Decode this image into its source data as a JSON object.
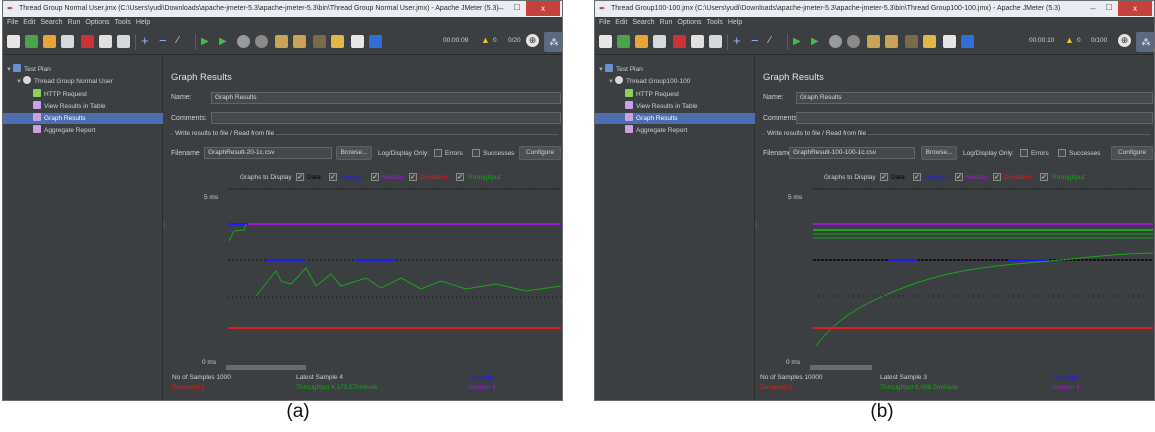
{
  "panels": [
    {
      "id": "a",
      "caption": "(a)",
      "window_title": "Thread Group Normal User.jmx (C:\\Users\\yudi\\Downloads\\apache-jmeter-5.3\\apache-jmeter-5.3\\bin\\Thread Group Normal User.jmx) - Apache JMeter (5.3)",
      "menu": [
        "File",
        "Edit",
        "Search",
        "Run",
        "Options",
        "Tools",
        "Help"
      ],
      "toolbar": {
        "elapsed": "00:00:09",
        "warnings": "0",
        "threads": "0/20",
        "window_controls": {
          "close": "x"
        }
      },
      "tree": {
        "test_plan": "Test Plan",
        "thread_group": "Thread Group Normal User",
        "items": [
          "HTTP Request",
          "View Results in Table",
          "Graph Results",
          "Aggregate Report"
        ],
        "selected": "Graph Results"
      },
      "main": {
        "heading": "Graph Results",
        "name_label": "Name:",
        "name_value": "Graph Results",
        "comments_label": "Comments:",
        "fieldset_legend": "Write results to file / Read from file",
        "filename_label": "Filename",
        "filename_value": "GraphResult-20-1c.csv",
        "browse": "Browse...",
        "log_display_only": "Log/Display Only:",
        "errors": "Errors",
        "successes": "Successes",
        "configure": "Configure",
        "graphs_to_display": "Graphs to Display",
        "legend": [
          {
            "label": "Data",
            "color": "#000000"
          },
          {
            "label": "Average",
            "color": "#1a1aff"
          },
          {
            "label": "Median",
            "color": "#9b1bd1"
          },
          {
            "label": "Deviation",
            "color": "#e01d1d"
          },
          {
            "label": "Throughput",
            "color": "#1fa01f"
          }
        ],
        "y_top": "5 ms",
        "y_bottom": "0 ms",
        "no_of_samples": "No of Samples 1000",
        "latest_sample": "Latest Sample 4",
        "average": "Average 4",
        "deviation": "Deviation 1",
        "throughput": "Throughput 4,172.57/minute",
        "median": "Median 4"
      }
    },
    {
      "id": "b",
      "caption": "(b)",
      "window_title": "Thread Group100-100.jmx (C:\\Users\\yudi\\Downloads\\apache-jmeter-5.3\\apache-jmeter-5.3\\bin\\Thread Group100-100.jmx) - Apache JMeter (5.3)",
      "menu": [
        "File",
        "Edit",
        "Search",
        "Run",
        "Options",
        "Tools",
        "Help"
      ],
      "toolbar": {
        "elapsed": "00:00:10",
        "warnings": "0",
        "threads": "0/100",
        "window_controls": {
          "close": "x"
        }
      },
      "tree": {
        "test_plan": "Test Plan",
        "thread_group": "Thread Group100-100",
        "items": [
          "HTTP Request",
          "View Results in Table",
          "Graph Results",
          "Aggregate Report"
        ],
        "selected": "Graph Results"
      },
      "main": {
        "heading": "Graph Results",
        "name_label": "Name:",
        "name_value": "Graph Results",
        "comments_label": "Comments:",
        "fieldset_legend": "Write results to file / Read from file",
        "filename_label": "Filename",
        "filename_value": "GraphResult-100-100-1c.csv",
        "browse": "Browse...",
        "log_display_only": "Log/Display Only:",
        "errors": "Errors",
        "successes": "Successes",
        "configure": "Configure",
        "graphs_to_display": "Graphs to Display",
        "legend": [
          {
            "label": "Data",
            "color": "#000000"
          },
          {
            "label": "Average",
            "color": "#1a1aff"
          },
          {
            "label": "Median",
            "color": "#9b1bd1"
          },
          {
            "label": "Deviation",
            "color": "#e01d1d"
          },
          {
            "label": "Throughput",
            "color": "#1fa01f"
          }
        ],
        "y_top": "5 ms",
        "y_bottom": "0 ms",
        "no_of_samples": "No of Samples 10000",
        "latest_sample": "Latest Sample 3",
        "average": "Average 4",
        "deviation": "Deviation 1",
        "throughput": "Throughput 6,098.5/minute",
        "median": "Median 4"
      }
    }
  ]
}
